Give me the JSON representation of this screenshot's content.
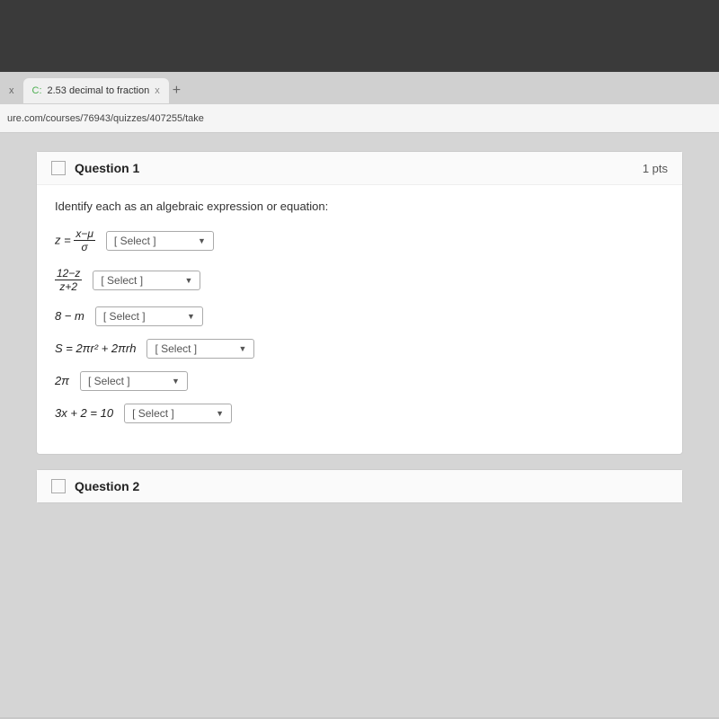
{
  "browser": {
    "dark_area_height": 80,
    "tab_close_left": "x",
    "tab_label": "2.53 decimal to fraction",
    "tab_close": "x",
    "tab_new": "+",
    "address": "ure.com/courses/76943/quizzes/407255/take"
  },
  "question1": {
    "title": "Question 1",
    "pts": "1 pts",
    "instruction": "Identify each as an algebraic expression or equation:",
    "rows": [
      {
        "id": "row1",
        "expr_text": "z = (x−μ)/σ",
        "select_label": "[ Select ]"
      },
      {
        "id": "row2",
        "expr_text": "(12−z)/(z+2)",
        "select_label": "[ Select ]"
      },
      {
        "id": "row3",
        "expr_text": "8 − m",
        "select_label": "[ Select ]"
      },
      {
        "id": "row4",
        "expr_text": "S = 2πr² + 2πrh",
        "select_label": "[ Select ]"
      },
      {
        "id": "row5",
        "expr_text": "2π",
        "select_label": "[ Select ]"
      },
      {
        "id": "row6",
        "expr_text": "3x + 2 = 10",
        "select_label": "[ Select ]"
      }
    ]
  },
  "question2": {
    "title": "Question 2"
  }
}
